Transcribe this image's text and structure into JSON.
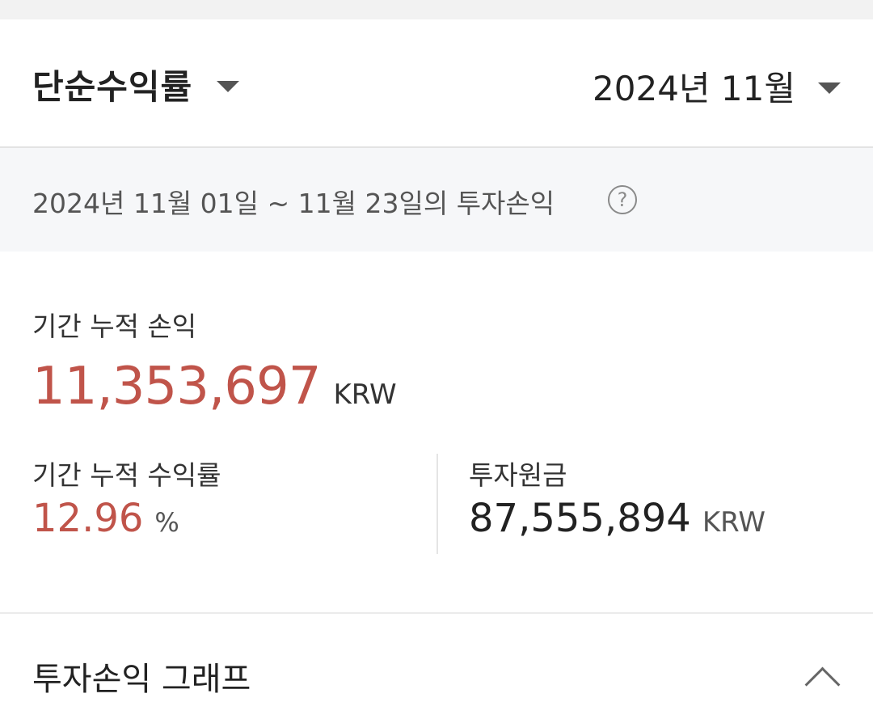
{
  "header": {
    "type_select_label": "단순수익률",
    "date_select_label": "2024년 11월"
  },
  "period": {
    "text": "2024년 11월 01일 ~ 11월 23일의 투자손익",
    "help_icon": "?"
  },
  "summary": {
    "cumulative_profit_label": "기간 누적 손익",
    "cumulative_profit_value": "11,353,697",
    "cumulative_profit_unit": "KRW",
    "cumulative_rate_label": "기간 누적 수익률",
    "cumulative_rate_value": "12.96",
    "cumulative_rate_unit": "%",
    "principal_label": "투자원금",
    "principal_value": "87,555,894",
    "principal_unit": "KRW"
  },
  "graph": {
    "title": "투자손익 그래프"
  },
  "colors": {
    "profit_red": "#c0544a",
    "text_dark": "#222222",
    "period_bg": "#f6f7f9"
  },
  "icons": {
    "type_caret": "caret-down-icon",
    "date_caret": "caret-down-icon",
    "help": "help-circle-icon",
    "collapse": "chevron-up-icon"
  }
}
